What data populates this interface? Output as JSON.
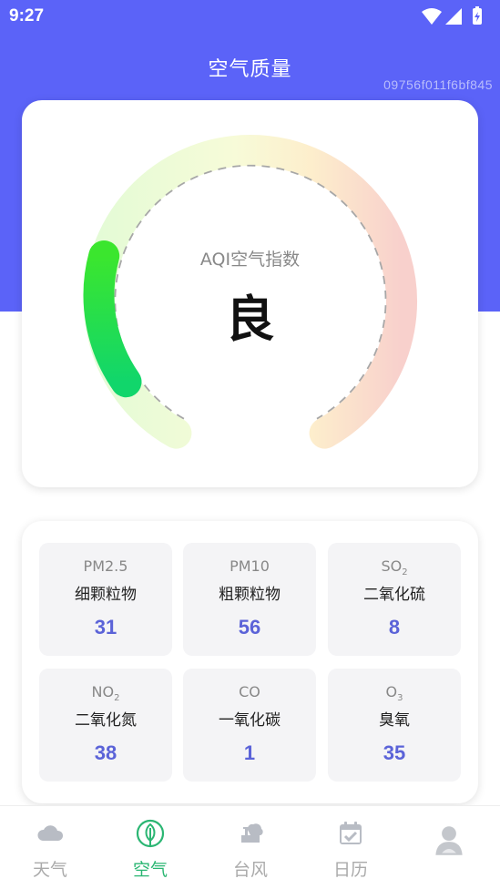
{
  "status_bar": {
    "time": "9:27"
  },
  "header": {
    "title": "空气质量",
    "device_id": "09756f011f6bf845",
    "accent_color": "#5b63f8"
  },
  "gauge": {
    "label": "AQI空气指数",
    "level_text": "良",
    "level_fraction": 0.2,
    "start_color": "#11d66b",
    "end_color": "#f5c9c4"
  },
  "pollutants": [
    {
      "code": "PM2.5",
      "sub": "",
      "name": "细颗粒物",
      "value": "31"
    },
    {
      "code": "PM10",
      "sub": "",
      "name": "粗颗粒物",
      "value": "56"
    },
    {
      "code": "SO",
      "sub": "2",
      "name": "二氧化硫",
      "value": "8"
    },
    {
      "code": "NO",
      "sub": "2",
      "name": "二氧化氮",
      "value": "38"
    },
    {
      "code": "CO",
      "sub": "",
      "name": "一氧化碳",
      "value": "1"
    },
    {
      "code": "O",
      "sub": "3",
      "name": "臭氧",
      "value": "35"
    }
  ],
  "nav": {
    "items": [
      {
        "label": "天气",
        "icon": "cloud-icon",
        "active": false
      },
      {
        "label": "空气",
        "icon": "leaf-icon",
        "active": true
      },
      {
        "label": "台风",
        "icon": "typhoon-icon",
        "active": false
      },
      {
        "label": "日历",
        "icon": "calendar-icon",
        "active": false
      },
      {
        "label": "",
        "icon": "profile-icon",
        "active": false
      }
    ],
    "active_color": "#2bb673",
    "inactive_color": "#aaaaaa"
  }
}
